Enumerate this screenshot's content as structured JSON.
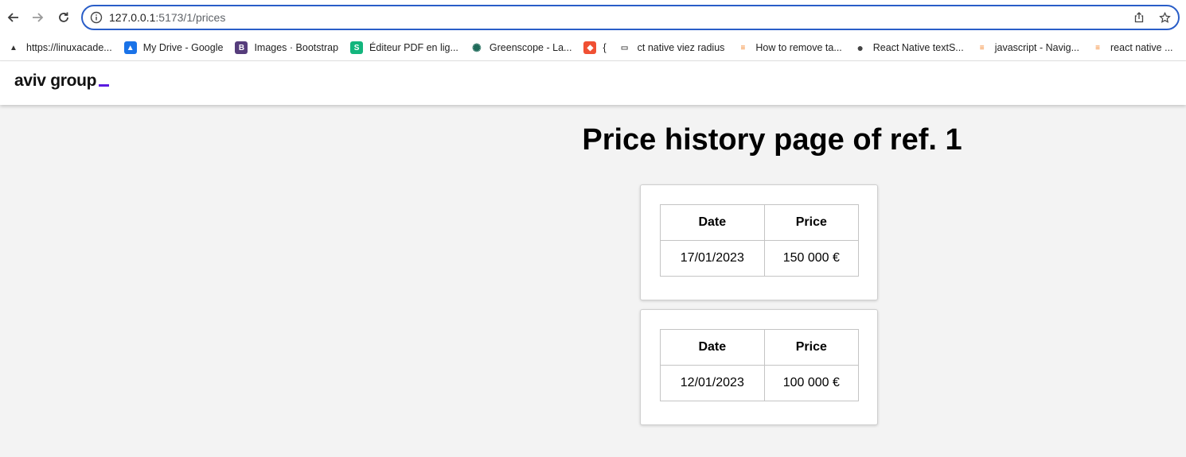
{
  "browser": {
    "url_host": "127.0.0.1",
    "url_path": ":5173/1/prices",
    "bookmarks": [
      {
        "label": "https://linuxacade...",
        "icon": "graduation-cap-icon",
        "color": "#333333"
      },
      {
        "label": "My Drive - Google",
        "icon": "google-drive-icon",
        "color": "#1a73e8"
      },
      {
        "label": "Images · Bootstrap",
        "icon": "bootstrap-icon",
        "color": "#563d7c"
      },
      {
        "label": "Éditeur PDF en lig...",
        "icon": "sejda-icon",
        "color": "#13b57d"
      },
      {
        "label": "Greenscope - La...",
        "icon": "greenscope-icon",
        "color": "#1f6b5a"
      },
      {
        "label": "{",
        "icon": "git-icon",
        "color": "#f05033"
      },
      {
        "label": "ct native viez radius",
        "icon": "folder-icon",
        "color": "#555555"
      },
      {
        "label": "How to remove ta...",
        "icon": "stackoverflow-icon",
        "color": "#f48024"
      },
      {
        "label": "React Native textS...",
        "icon": "globe-icon",
        "color": "#444444"
      },
      {
        "label": "javascript - Navig...",
        "icon": "stackoverflow-icon",
        "color": "#f48024"
      },
      {
        "label": "react native ...",
        "icon": "stackoverflow-icon",
        "color": "#f48024"
      }
    ]
  },
  "header": {
    "logo_text": "aviv group",
    "accent_color": "#5a1be0"
  },
  "main": {
    "title": "Price history page of ref. 1",
    "cards": [
      {
        "headers": {
          "date": "Date",
          "price": "Price"
        },
        "row": {
          "date": "17/01/2023",
          "price": "150 000 €"
        }
      },
      {
        "headers": {
          "date": "Date",
          "price": "Price"
        },
        "row": {
          "date": "12/01/2023",
          "price": "100 000 €"
        }
      }
    ]
  }
}
